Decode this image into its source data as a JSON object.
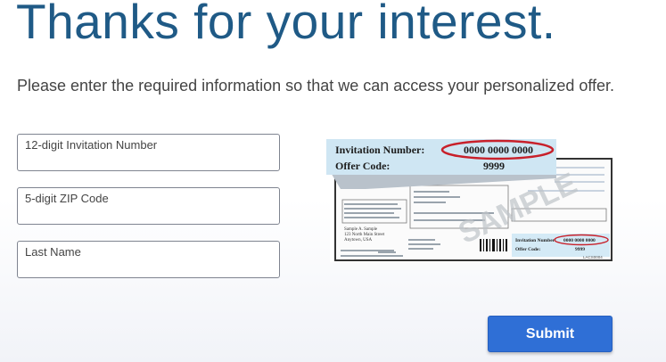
{
  "page": {
    "title": "Thanks for your interest.",
    "subtitle": "Please enter the required information so that we can access your personalized offer."
  },
  "form": {
    "fields": [
      {
        "label": "12-digit Invitation Number",
        "value": ""
      },
      {
        "label": "5-digit ZIP Code",
        "value": ""
      },
      {
        "label": "Last Name",
        "value": ""
      }
    ],
    "submit_label": "Submit"
  },
  "sample_image": {
    "invitation_label": "Invitation Number:",
    "invitation_value": "0000 0000 0000",
    "offer_label": "Offer Code:",
    "offer_value": "9999",
    "watermark": "SAMPLE",
    "sender_name": "Sample A. Sample",
    "sender_street": "123 North Main Street",
    "sender_city": "Anytown, USA",
    "small_invitation_label": "Invitation Number:",
    "small_invitation_value": "0000 0000 0000",
    "small_offer_label": "Offer Code:",
    "small_offer_value": "9999",
    "vendor_code": "LACS0004"
  },
  "colors": {
    "title": "#1f5a86",
    "submit_bg": "#2f6fd6",
    "highlight_red": "#c8202a",
    "callout_bg": "#cfe6f3"
  }
}
